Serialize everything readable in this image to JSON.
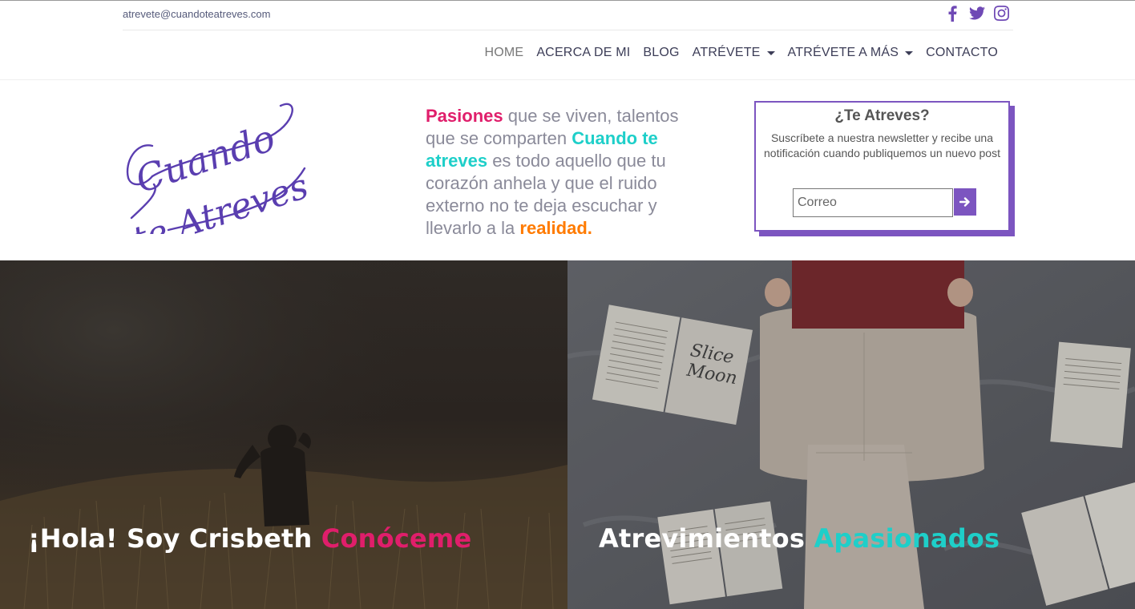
{
  "topbar": {
    "email": "atrevete@cuandoteatreves.com",
    "social": [
      "facebook-icon",
      "twitter-icon",
      "instagram-icon"
    ]
  },
  "nav": {
    "items": [
      {
        "label": "HOME",
        "active": true
      },
      {
        "label": "ACERCA DE MI"
      },
      {
        "label": "BLOG"
      },
      {
        "label": "ATRÉVETE",
        "dropdown": true
      },
      {
        "label": "ATRÉVETE A MÁS",
        "dropdown": true
      },
      {
        "label": "CONTACTO"
      }
    ]
  },
  "logo": {
    "text_line1": "Cuando",
    "text_line2": "te Atreves"
  },
  "tagline": {
    "part1": "Pasiones",
    "part2": " que se viven, talentos que se comparten ",
    "part3": "Cuando te atreves",
    "part4": " es todo aquello que tu corazón anhela y que el ruido externo no te deja escuchar y llevarlo a la ",
    "part5": "realidad."
  },
  "newsletter": {
    "title": "¿Te Atreves?",
    "description": "Suscríbete a nuestra newsletter y recibe una notificación cuando publiquemos un nuevo post",
    "placeholder": "Correo",
    "submit_icon": "arrow-right-icon"
  },
  "panels": {
    "left": {
      "title": "¡Hola! Soy Crisbeth ",
      "highlight": "Conóceme"
    },
    "right": {
      "title": "Atrevimientos ",
      "highlight": "Apasionados"
    }
  },
  "colors": {
    "purple": "#7c55c0",
    "pink": "#e01e6b",
    "teal": "#1ecfc9",
    "orange": "#ff7b00"
  }
}
